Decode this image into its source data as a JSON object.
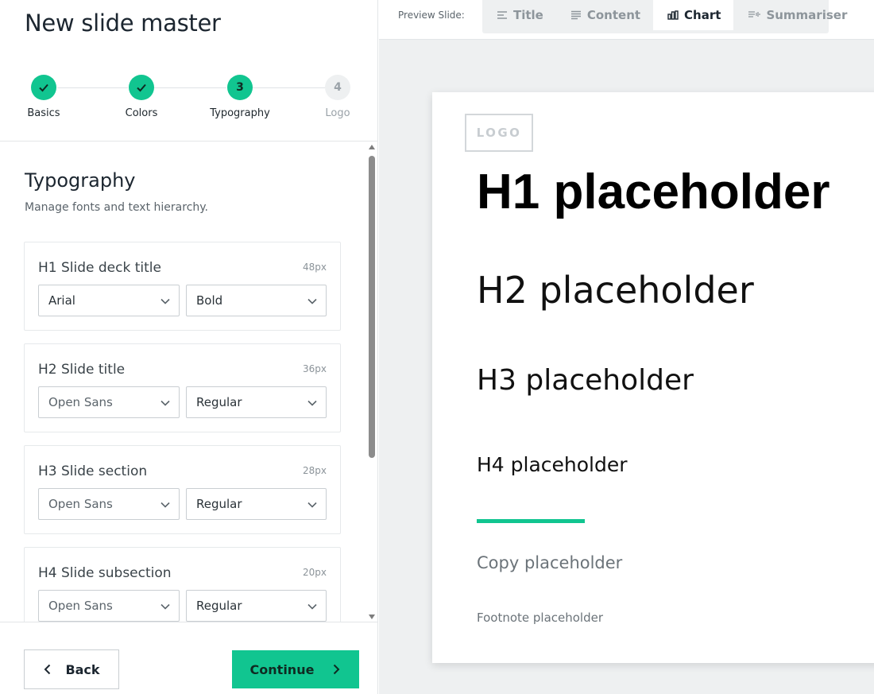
{
  "page": {
    "title": "New slide master"
  },
  "stepper": {
    "steps": [
      {
        "label": "Basics",
        "number": "",
        "state": "done"
      },
      {
        "label": "Colors",
        "number": "",
        "state": "done"
      },
      {
        "label": "Typography",
        "number": "3",
        "state": "current"
      },
      {
        "label": "Logo",
        "number": "4",
        "state": "todo"
      }
    ]
  },
  "section": {
    "title": "Typography",
    "subtitle": "Manage fonts and text hierarchy."
  },
  "cards": [
    {
      "title": "H1 Slide deck title",
      "size": "48px",
      "font": "Arial",
      "weight": "Bold"
    },
    {
      "title": "H2 Slide title",
      "size": "36px",
      "font": "Open Sans",
      "weight": "Regular"
    },
    {
      "title": "H3 Slide section",
      "size": "28px",
      "font": "Open Sans",
      "weight": "Regular"
    },
    {
      "title": "H4 Slide subsection",
      "size": "20px",
      "font": "Open Sans",
      "weight": "Regular"
    }
  ],
  "footer": {
    "back_label": "Back",
    "continue_label": "Continue"
  },
  "preview": {
    "label": "Preview Slide:",
    "tabs": [
      {
        "label": "Title",
        "icon": "title-lines-icon",
        "active": false
      },
      {
        "label": "Content",
        "icon": "content-lines-icon",
        "active": false
      },
      {
        "label": "Chart",
        "icon": "bar-chart-icon",
        "active": true
      },
      {
        "label": "Summariser",
        "icon": "summary-icon",
        "active": false
      }
    ]
  },
  "slide": {
    "logo": "LOGO",
    "h1": "H1 placeholder",
    "h2": "H2 placeholder",
    "h3": "H3 placeholder",
    "h4": "H4 placeholder",
    "copy": "Copy placeholder",
    "footnote": "Footnote placeholder"
  },
  "colors": {
    "accent": "#11c590"
  }
}
